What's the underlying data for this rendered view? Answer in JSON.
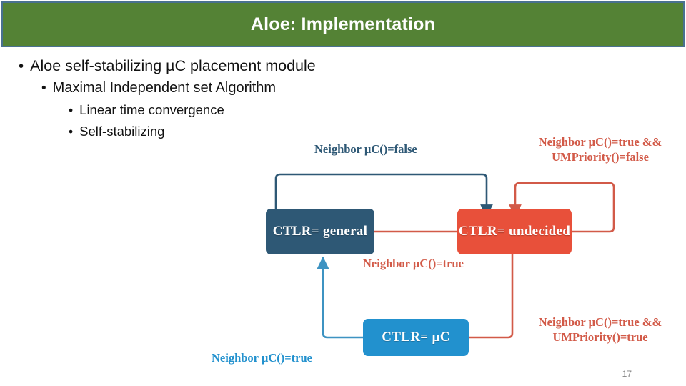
{
  "slide": {
    "title": "Aloe: Implementation",
    "page_number": "17",
    "colors": {
      "title_bar_bg": "#548235",
      "title_bar_border": "#4a7190",
      "title_text": "#ffffff",
      "navy": "#2e5875",
      "red": "#e8503a",
      "red_label": "#d25a48",
      "light_blue": "#2291ce"
    }
  },
  "bullets": [
    {
      "level": 1,
      "marker": "•",
      "text": "Aloe self-stabilizing µC placement module"
    },
    {
      "level": 2,
      "marker": "•",
      "text": "Maximal Independent set Algorithm"
    },
    {
      "level": 3,
      "marker": "•",
      "text": "Linear time convergence"
    },
    {
      "level": 4,
      "marker": "•",
      "text": "Self-stabilizing"
    }
  ],
  "diagram": {
    "type": "state-machine",
    "nodes": [
      {
        "id": "general",
        "label": "CTLR= general",
        "color": "#2e5875"
      },
      {
        "id": "undecided",
        "label": "CTLR= undecided",
        "color": "#e8503a"
      },
      {
        "id": "uc",
        "label": "CTLR= µC",
        "color": "#2291ce"
      }
    ],
    "edges": [
      {
        "id": "general-to-undecided",
        "from": "general",
        "to": "undecided",
        "color": "#2e5875",
        "label_lines": [
          "Neighbor µC()=false"
        ]
      },
      {
        "id": "undecided-self-loop",
        "from": "undecided",
        "to": "undecided",
        "color": "#d25a48",
        "label_lines": [
          "Neighbor µC()=true &&",
          "UMPriority()=false"
        ]
      },
      {
        "id": "undecided-to-general",
        "from": "undecided",
        "to": "general",
        "color": "#d25a48",
        "label_lines": [
          "Neighbor µC()=true"
        ]
      },
      {
        "id": "undecided-to-uc",
        "from": "undecided",
        "to": "uc",
        "color": "#d25a48",
        "label_lines": [
          "Neighbor µC()=true &&",
          "UMPriority()=true"
        ]
      },
      {
        "id": "uc-to-general",
        "from": "uc",
        "to": "general",
        "color": "#2291ce",
        "label_lines": [
          "Neighbor µC()=true"
        ]
      }
    ]
  }
}
